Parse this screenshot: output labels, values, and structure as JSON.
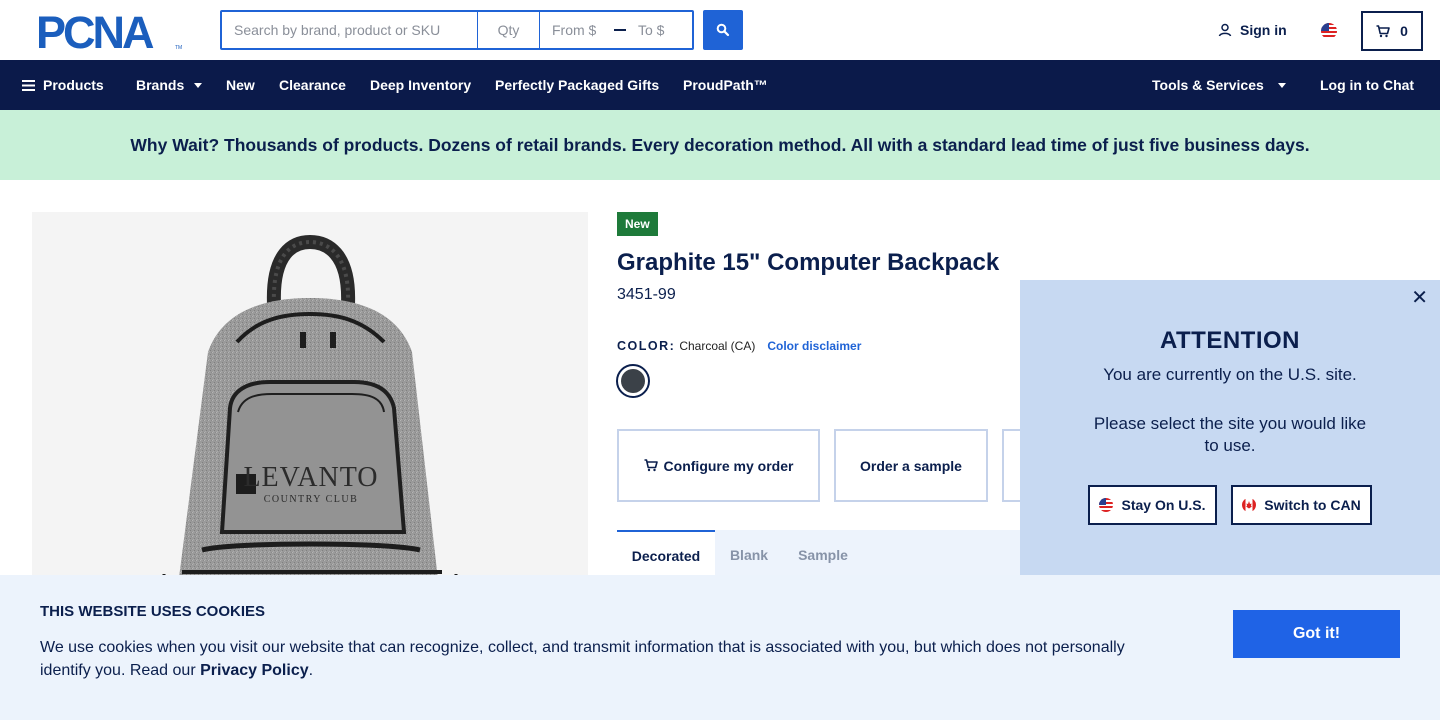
{
  "header": {
    "logo_text": "PCNA",
    "search_placeholder": "Search by brand, product or SKU",
    "qty_placeholder": "Qty",
    "from_placeholder": "From $",
    "to_placeholder": "To $",
    "signin_label": "Sign in",
    "cart_count": "0"
  },
  "nav": {
    "items": [
      {
        "label": "Products"
      },
      {
        "label": "Brands"
      },
      {
        "label": "New"
      },
      {
        "label": "Clearance"
      },
      {
        "label": "Deep Inventory"
      },
      {
        "label": "Perfectly Packaged Gifts"
      },
      {
        "label": "ProudPath™"
      }
    ],
    "tools_label": "Tools & Services",
    "chat_label": "Log in to Chat"
  },
  "promo": {
    "text": "Why Wait? Thousands of products. Dozens of retail brands. Every decoration method. All with a standard lead time of just five business days."
  },
  "product": {
    "badge": "New",
    "title": "Graphite 15\" Computer Backpack",
    "sku": "3451-99",
    "color_label": "COLOR:",
    "color_value": "Charcoal (CA)",
    "color_disclaimer": "Color disclaimer",
    "swatch_color": "#3b4148",
    "print_brand": "LEVANTO",
    "print_sub": "COUNTRY CLUB",
    "actions": {
      "configure": "Configure my order",
      "sample": "Order a sample"
    },
    "tabs": [
      {
        "label": "Decorated"
      },
      {
        "label": "Blank"
      },
      {
        "label": "Sample"
      }
    ]
  },
  "modal": {
    "title": "ATTENTION",
    "line1": "You are currently on the U.S. site.",
    "line2": "Please select the site you would like to use.",
    "stay_label": "Stay On U.S.",
    "switch_label": "Switch to CAN"
  },
  "cookie": {
    "title": "THIS WEBSITE USES COOKIES",
    "text": "We use cookies when you visit our website that can recognize, collect, and transmit information that is associated with you, but which does not personally identify you. Read our",
    "link": "Privacy Policy",
    "period": ".",
    "button": "Got it!"
  },
  "colors": {
    "navy": "#0b1a4a",
    "accent": "#1f63d6",
    "promo_bg": "#c8f0d8",
    "new_badge": "#1e7a3a"
  }
}
